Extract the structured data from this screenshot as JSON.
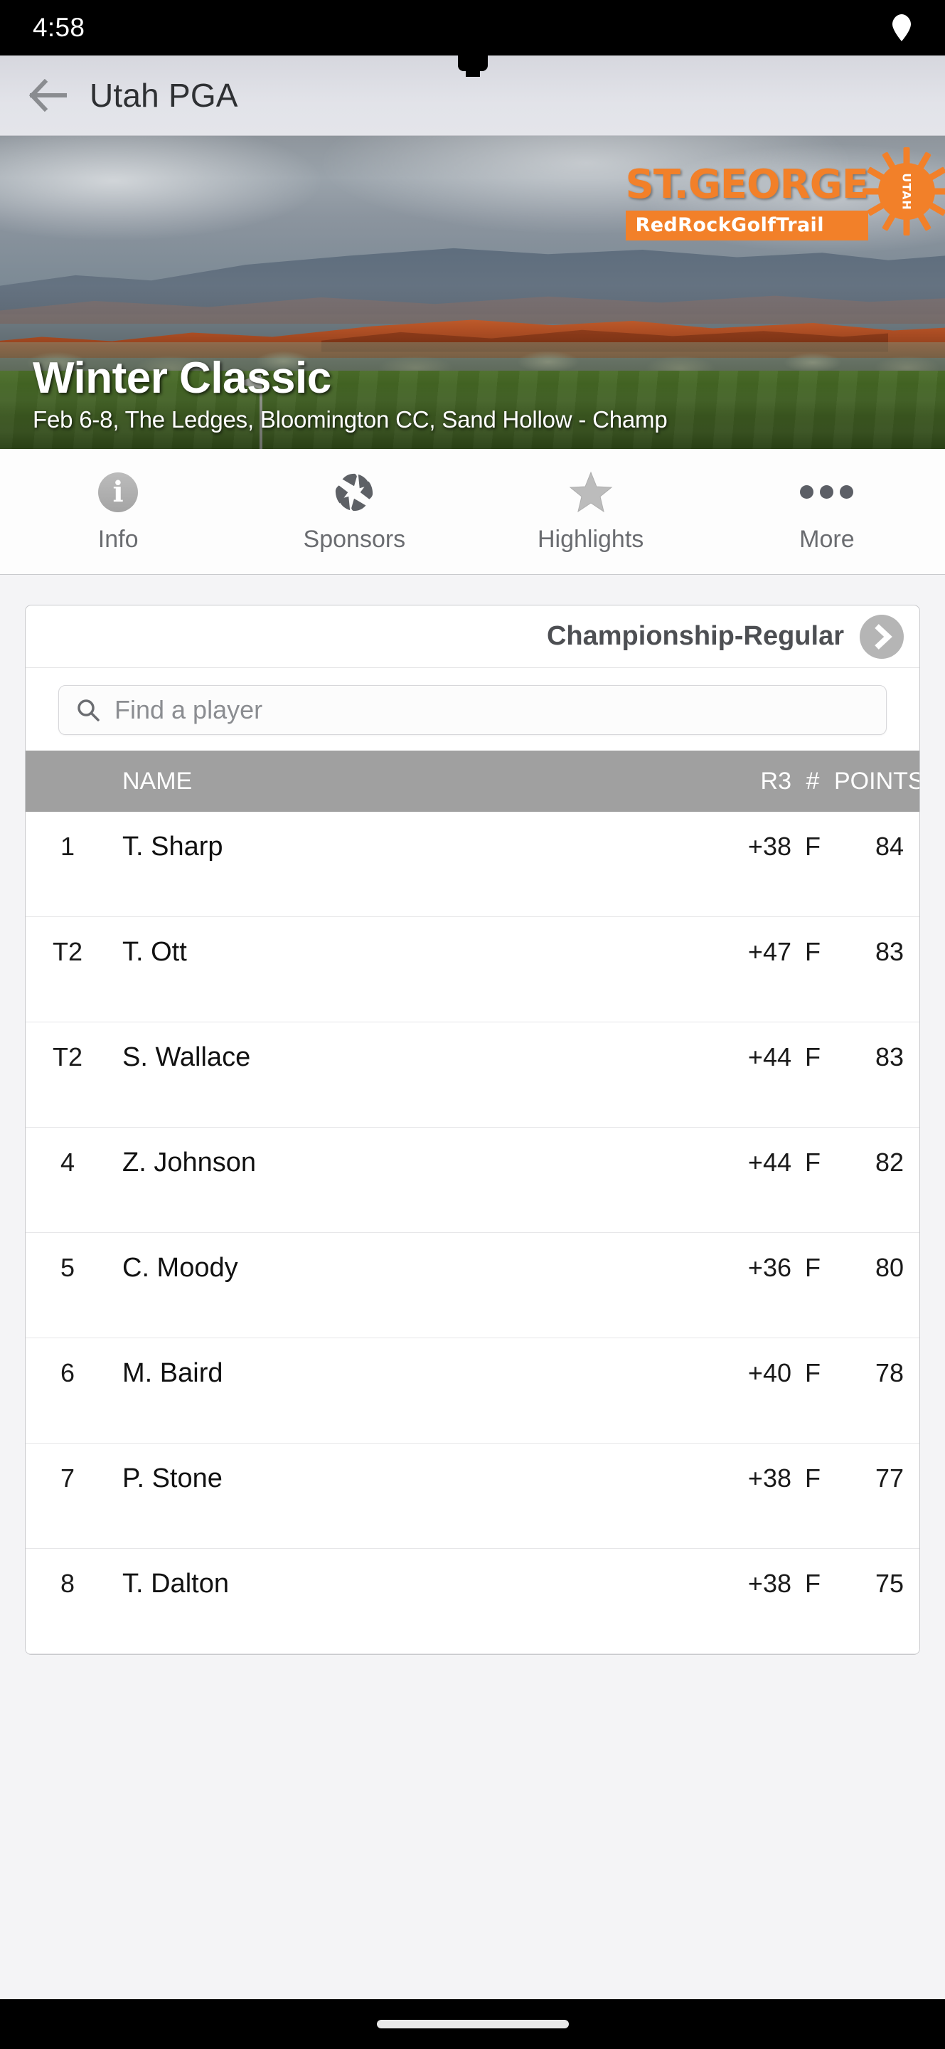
{
  "status_bar": {
    "time": "4:58",
    "indicator_icon": "location-arrow-icon"
  },
  "nav": {
    "back_icon": "back-arrow-icon",
    "title": "Utah PGA"
  },
  "hero": {
    "logo": {
      "top_text": "ST.GEORGE",
      "bar_text": "RedRockGolfTrail",
      "sun_text": "UTAH",
      "accent_color": "#f28029"
    },
    "event_title": "Winter Classic",
    "event_subtitle": "Feb 6-8, The Ledges, Bloomington CC, Sand Hollow - Champ"
  },
  "tabs": [
    {
      "label": "Info",
      "icon": "info-circle-icon"
    },
    {
      "label": "Sponsors",
      "icon": "camera-aperture-icon"
    },
    {
      "label": "Highlights",
      "icon": "star-icon"
    },
    {
      "label": "More",
      "icon": "ellipsis-icon"
    }
  ],
  "leaderboard": {
    "selector_label": "Championship-Regular",
    "selector_icon": "chevron-right-icon",
    "search": {
      "placeholder": "Find a player",
      "value": "",
      "icon": "search-icon"
    },
    "columns": {
      "rank": "",
      "name": "NAME",
      "r3": "R3",
      "num": "#",
      "points": "POINTS"
    },
    "rows": [
      {
        "rank": "1",
        "name": "T. Sharp",
        "r3": "+38",
        "num": "F",
        "points": "84"
      },
      {
        "rank": "T2",
        "name": "T. Ott",
        "r3": "+47",
        "num": "F",
        "points": "83"
      },
      {
        "rank": "T2",
        "name": "S. Wallace",
        "r3": "+44",
        "num": "F",
        "points": "83"
      },
      {
        "rank": "4",
        "name": "Z. Johnson",
        "r3": "+44",
        "num": "F",
        "points": "82"
      },
      {
        "rank": "5",
        "name": "C. Moody",
        "r3": "+36",
        "num": "F",
        "points": "80"
      },
      {
        "rank": "6",
        "name": "M. Baird",
        "r3": "+40",
        "num": "F",
        "points": "78"
      },
      {
        "rank": "7",
        "name": "P. Stone",
        "r3": "+38",
        "num": "F",
        "points": "77"
      },
      {
        "rank": "8",
        "name": "T. Dalton",
        "r3": "+38",
        "num": "F",
        "points": "75"
      }
    ]
  },
  "bottom_nav": {
    "home_indicator": "home-indicator"
  },
  "colors": {
    "accent_orange": "#f28029",
    "header_gray": "#a0a0a0",
    "nav_bg": "#e2e3e9"
  }
}
